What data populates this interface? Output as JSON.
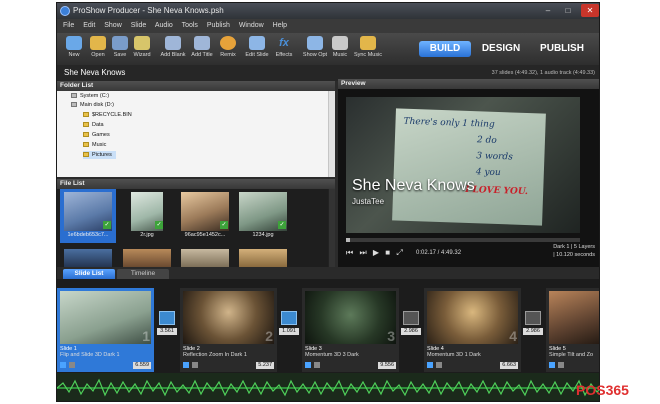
{
  "window": {
    "title": "ProShow Producer - She Neva Knows.psh"
  },
  "menu": [
    "File",
    "Edit",
    "Show",
    "Slide",
    "Audio",
    "Tools",
    "Publish",
    "Window",
    "Help"
  ],
  "toolbar": {
    "tools": [
      {
        "label": "New",
        "icon": "new-show-icon",
        "color": "#6aa8e8"
      },
      {
        "label": "Open",
        "icon": "open-folder-icon",
        "color": "#e2b64a"
      },
      {
        "label": "Save",
        "icon": "save-disk-icon",
        "color": "#7a9cc9"
      },
      {
        "label": "Wizard",
        "icon": "wizard-icon",
        "color": "#d7c56a"
      },
      {
        "label": "Add Blank",
        "icon": "add-blank-icon",
        "color": "#9fb6d8"
      },
      {
        "label": "Add Title",
        "icon": "add-title-icon",
        "color": "#9fb6d8"
      },
      {
        "label": "Remix",
        "icon": "remix-icon",
        "color": "#e6a23a"
      },
      {
        "label": "Edit Slide",
        "icon": "edit-slide-icon",
        "color": "#8db6e6"
      },
      {
        "label": "Effects",
        "icon": "effects-fx-icon",
        "color": "#4a8fd8"
      },
      {
        "label": "Show Opt",
        "icon": "show-options-icon",
        "color": "#8db6e6"
      },
      {
        "label": "Music",
        "icon": "music-speaker-icon",
        "color": "#c9c9c9"
      },
      {
        "label": "Sync Music",
        "icon": "sync-music-icon",
        "color": "#e2b64a"
      }
    ],
    "modes": [
      "BUILD",
      "DESIGN",
      "PUBLISH"
    ]
  },
  "show": {
    "name": "She Neva Knows",
    "info": "37 slides (4:49.32), 1 audio track (4:49.33)"
  },
  "folder_list": {
    "header": "Folder List",
    "items": [
      {
        "label": "System (C:)",
        "selected": false
      },
      {
        "label": "Main disk (D:)",
        "selected": false
      },
      {
        "label": "$RECYCLE.BIN",
        "selected": false
      },
      {
        "label": "Data",
        "selected": false
      },
      {
        "label": "Games",
        "selected": false
      },
      {
        "label": "Music",
        "selected": false
      },
      {
        "label": "Pictures",
        "selected": true
      }
    ]
  },
  "file_list": {
    "header": "File List",
    "files": [
      {
        "name": "1e6bdeb653c7...",
        "selected": true
      },
      {
        "name": "2r.jpg",
        "selected": false
      },
      {
        "name": "96ac95e1452c...",
        "selected": false
      },
      {
        "name": "1234.jpg",
        "selected": false
      }
    ]
  },
  "preview": {
    "header": "Preview",
    "title_text": "She Neva Knows",
    "subtitle_text": "JustaTee",
    "paper_lines": [
      "There's only 1 thing",
      "2 do",
      "3 words",
      "4 you",
      "I LOVE YOU."
    ],
    "time": "0:02.17 / 4:49.32",
    "layer_info": "Dark 1  |  5 Layers",
    "duration_info": "|  10.120 seconds",
    "controls": [
      "⏮",
      "⏭",
      "▶",
      "■",
      "⤢"
    ]
  },
  "tabs": [
    "Slide List",
    "Timeline"
  ],
  "slides": [
    {
      "name": "Slide 1",
      "effect": "Flip and Slide 3D Dark 1",
      "duration": "6.559",
      "num": "1",
      "selected": true
    },
    {
      "name": "Slide 2",
      "effect": "Reflection Zoom In Dark 1",
      "duration": "5.237",
      "num": "2",
      "selected": false
    },
    {
      "name": "Slide 3",
      "effect": "Momentum 3D 3 Dark",
      "duration": "9.556",
      "num": "3",
      "selected": false
    },
    {
      "name": "Slide 4",
      "effect": "Momentum 3D 1 Dark",
      "duration": "6.663",
      "num": "4",
      "selected": false
    },
    {
      "name": "Slide 5",
      "effect": "Simple Tilt and Zo",
      "duration": "",
      "num": "5",
      "selected": false
    }
  ],
  "transitions": [
    "3.561",
    "1.091",
    "2.986",
    "2.986"
  ],
  "watermark": {
    "prefix": "POS",
    "suffix": "365"
  }
}
